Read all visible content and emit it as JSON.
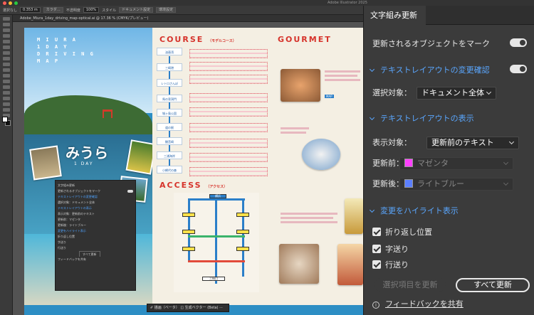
{
  "window": {
    "app_title": "Adobe Illustrator 2025",
    "traffic_colors": [
      "#ff5f57",
      "#febc2e",
      "#28c840"
    ]
  },
  "controlbar": {
    "label_a": "選択なし",
    "stroke_value": "0.353 m",
    "fill_label": "カラダ…",
    "brush_label": "不透明度",
    "opacity": "100%",
    "style_label": "スタイル",
    "doc_setup": "ドキュメント設定",
    "prefs": "環境設定"
  },
  "document": {
    "tab_label": "Adobe_Miura_1day_driving_map-optical.ai @ 17.36 % (CMYK/プレビュー)"
  },
  "artwork": {
    "vertical_title": [
      "M I U R A",
      "1  D A Y",
      "D R I V I N G",
      "M A P"
    ],
    "miura": "みうら",
    "oneday": "1 DAY",
    "course_title": "COURSE",
    "course_sub": "（モデルコース）",
    "access_title": "ACCESS",
    "access_sub": "（アクセス）",
    "gourmet_title": "GOURMET",
    "route_items": [
      "油壺湾",
      "三崎港",
      "レトロさんぽ",
      "馬の背洞門",
      "城ヶ島公園",
      "道の駅",
      "観音崎",
      "三浦海岸",
      "小網代の森"
    ],
    "map_label": "MAP",
    "map_stations": [
      "横浜",
      "三崎口"
    ]
  },
  "mini_panel": {
    "title": "文字組み更新",
    "rows": [
      "更新されるオブジェクトをマーク",
      "テキストレイアウトの変更確認",
      "選択対象：ドキュメント全体",
      "テキストレイアウトの表示",
      "表示対象：更新前のテキスト",
      "更新前：マゼンタ",
      "更新後：ライトブルー",
      "変更をハイライト表示",
      "折り返し位置",
      "字送り",
      "行送り"
    ],
    "update_all": "すべて更新",
    "feedback": "フィードバックを共有"
  },
  "floatbar": {
    "label": "✐ 描画（ベータ）  ◫ 生成ベクター (Beta)  ⋯"
  },
  "panel": {
    "tab_title": "文字組み更新",
    "mark_objects": "更新されるオブジェクトをマーク",
    "layout_check_section": "テキストレイアウトの変更確認",
    "selection_label": "選択対象：",
    "selection_value": "ドキュメント全体",
    "layout_display_section": "テキストレイアウトの表示",
    "display_label": "表示対象：",
    "display_value": "更新前のテキスト",
    "before_label": "更新前：",
    "before_value": "マゼンタ",
    "after_label": "更新後：",
    "after_value": "ライトブルー",
    "highlight_section": "変更をハイライト表示",
    "checks": [
      "折り返し位置",
      "字送り",
      "行送り"
    ],
    "update_selected": "選択項目を更新",
    "update_all": "すべて更新",
    "feedback": "フィードバックを共有",
    "info_glyph": "i"
  },
  "colors": {
    "accent_blue": "#5aa7ff",
    "magenta": "#ff40ff",
    "light_blue": "#5b7fff"
  }
}
